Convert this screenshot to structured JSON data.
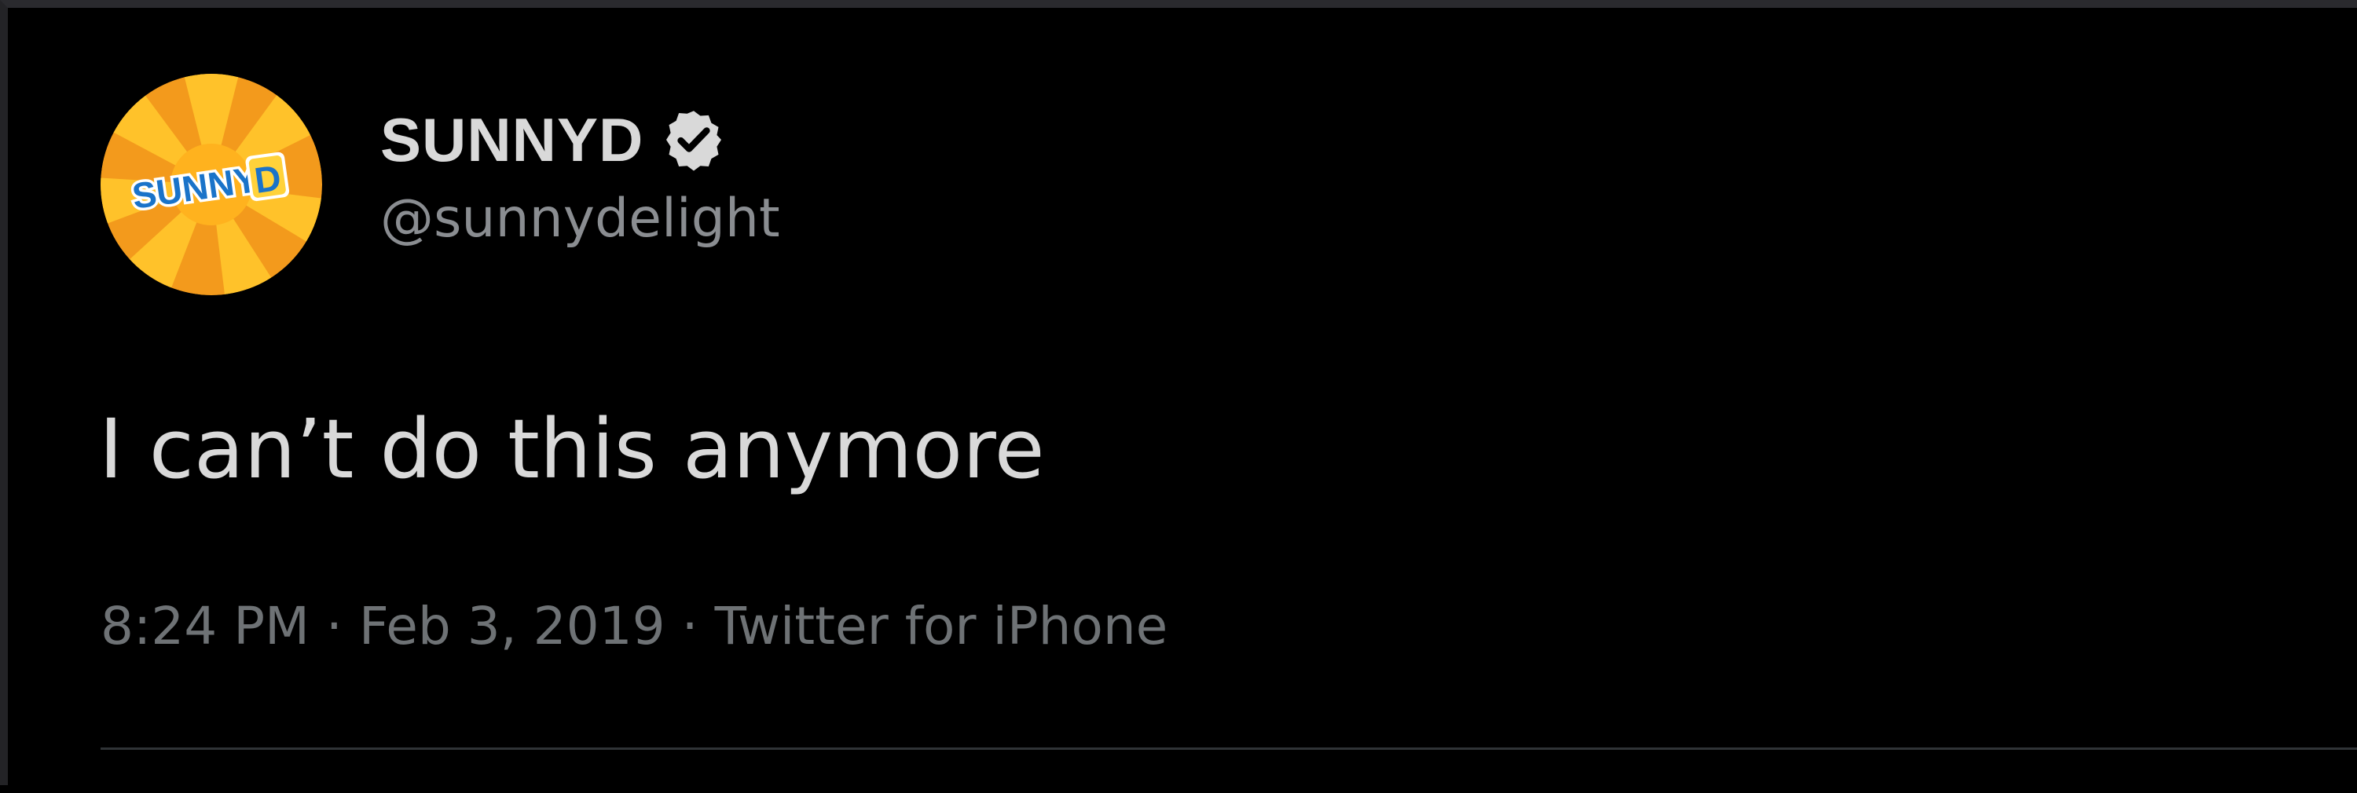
{
  "tweet": {
    "display_name": "SUNNYD",
    "handle": "@sunnydelight",
    "verified_icon": "verified-badge-icon",
    "avatar": {
      "logo_text": "SUNNY",
      "logo_letter": "D",
      "colors": {
        "ring": "#f39a1c",
        "rays_light": "#ffc22a",
        "rays_dark": "#f08a14",
        "logo_text": "#ffffff",
        "logo_badge": "#1a73c9"
      }
    },
    "text": "I can’t do this anymore",
    "time": "8:24 PM",
    "separator": " · ",
    "date": "Feb 3, 2019",
    "source": "Twitter for iPhone"
  },
  "colors": {
    "background": "#000000",
    "primary_text": "#d9d9d9",
    "secondary_text": "#8a8d91",
    "meta_text": "#6e7275",
    "divider": "#2f3336"
  }
}
